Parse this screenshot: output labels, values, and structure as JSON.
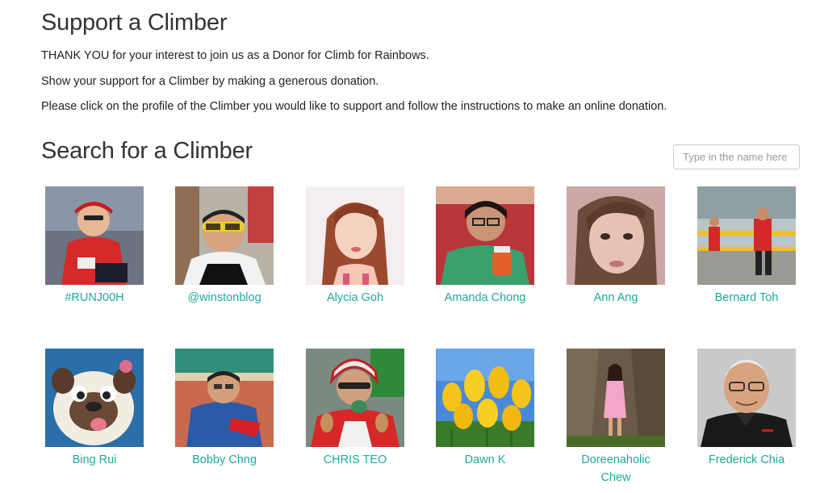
{
  "header": {
    "title": "Support a Climber",
    "intro": [
      "THANK YOU for your interest to join us as a Donor for Climb for Rainbows.",
      "Show your support for a Climber by making a generous donation.",
      "Please click on the profile of the Climber you would like to support and follow the instructions to make an online donation."
    ]
  },
  "search": {
    "title": "Search for a Climber",
    "placeholder": "Type in the name here"
  },
  "climbers": [
    {
      "name": "#RUNJ00H"
    },
    {
      "name": "@winstonblog"
    },
    {
      "name": "Alycia Goh"
    },
    {
      "name": "Amanda Chong"
    },
    {
      "name": "Ann Ang"
    },
    {
      "name": "Bernard Toh"
    },
    {
      "name": "Bing Rui"
    },
    {
      "name": "Bobby Chng"
    },
    {
      "name": "CHRIS TEO"
    },
    {
      "name": "Dawn K"
    },
    {
      "name": "Doreenaholic Chew"
    },
    {
      "name": "Frederick Chia"
    }
  ],
  "colors": {
    "link": "#1fa99a",
    "heading": "#333333"
  }
}
